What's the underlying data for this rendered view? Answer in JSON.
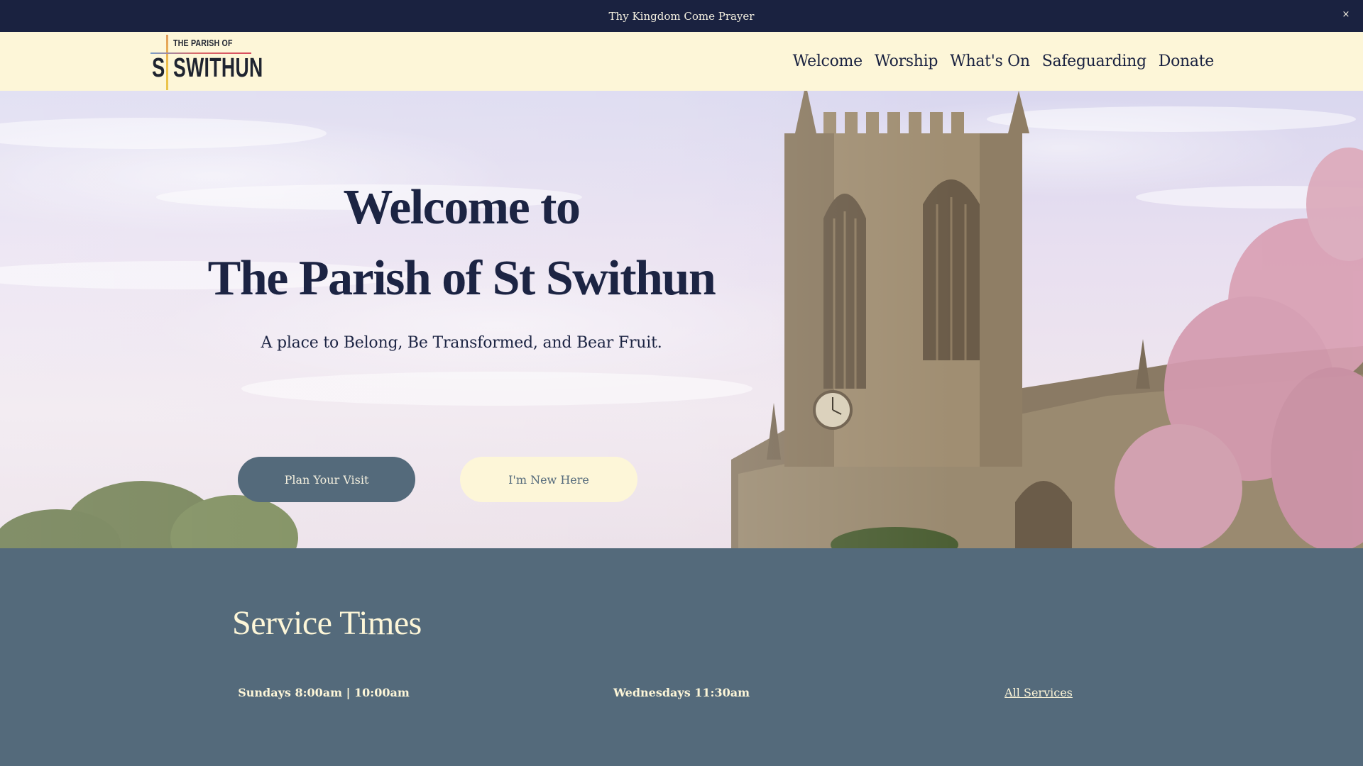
{
  "announcement": {
    "text": "Thy Kingdom Come Prayer",
    "close_glyph": "×",
    "close_icon": "close-icon"
  },
  "header": {
    "logo": {
      "top_text": "THE PARISH OF",
      "s_letter": "S",
      "main_text": "SWITHUN"
    },
    "nav": [
      {
        "label": "Welcome"
      },
      {
        "label": "Worship"
      },
      {
        "label": "What's On"
      },
      {
        "label": "Safeguarding"
      },
      {
        "label": "Donate"
      }
    ]
  },
  "hero": {
    "title_line1": "Welcome to",
    "title_line2": "The Parish of St Swithun",
    "subtitle": "A place to Belong, Be Transformed, and Bear Fruit.",
    "primary_button": "Plan Your Visit",
    "secondary_button": "I'm New Here"
  },
  "services": {
    "title": "Service Times",
    "items": [
      {
        "text": "Sundays 8:00am | 10:00am"
      },
      {
        "text": "Wednesdays 11:30am"
      },
      {
        "text": "All Services"
      }
    ]
  },
  "colors": {
    "navy": "#1a2240",
    "cream": "#fdf6d8",
    "slate": "#546a7b"
  }
}
